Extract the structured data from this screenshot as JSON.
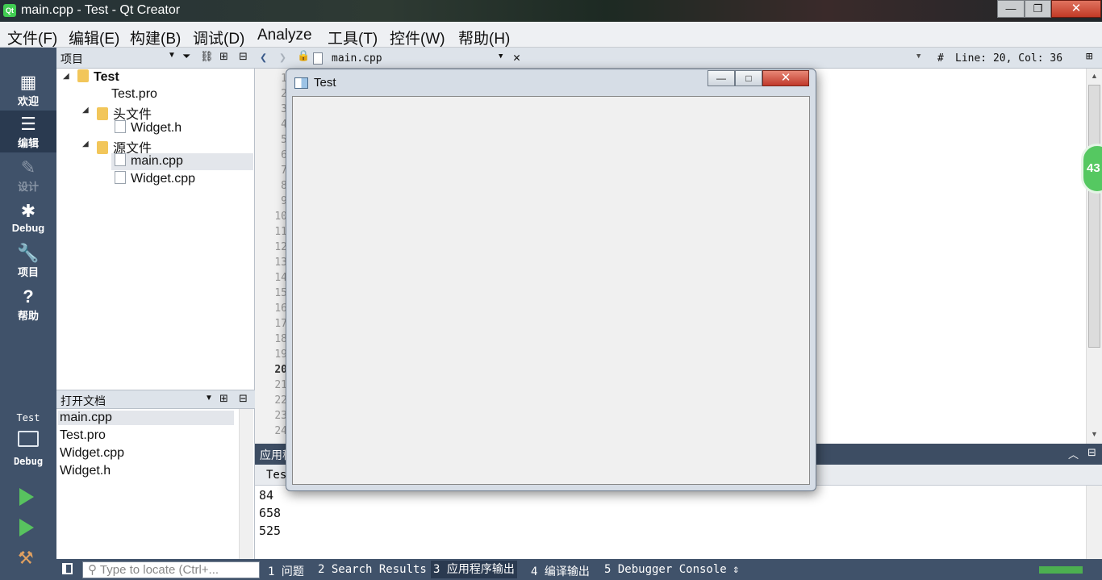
{
  "window": {
    "title": "main.cpp - Test - Qt Creator",
    "min_glyph": "—",
    "max_glyph": "❐",
    "close_glyph": "✕"
  },
  "menubar": [
    "文件(F)",
    "编辑(E)",
    "构建(B)",
    "调试(D)",
    "Analyze",
    "工具(T)",
    "控件(W)",
    "帮助(H)"
  ],
  "modes": [
    {
      "label": "欢迎",
      "icon": "grid-icon",
      "glyph": "▦"
    },
    {
      "label": "编辑",
      "icon": "edit-icon",
      "glyph": "☰"
    },
    {
      "label": "设计",
      "icon": "pencil-icon",
      "glyph": "✎"
    },
    {
      "label": "Debug",
      "icon": "bug-icon",
      "glyph": "✱"
    },
    {
      "label": "项目",
      "icon": "wrench-icon",
      "glyph": "🔧"
    },
    {
      "label": "帮助",
      "icon": "help-icon",
      "glyph": "?"
    }
  ],
  "kit": {
    "project": "Test",
    "config": "Debug"
  },
  "project_panel": {
    "title": "项目",
    "tree": [
      {
        "label": "Test",
        "level": 0,
        "kind": "project"
      },
      {
        "label": "Test.pro",
        "level": 1,
        "kind": "pro"
      },
      {
        "label": "头文件",
        "level": 1,
        "kind": "folder"
      },
      {
        "label": "Widget.h",
        "level": 2,
        "kind": "file"
      },
      {
        "label": "源文件",
        "level": 1,
        "kind": "folder"
      },
      {
        "label": "main.cpp",
        "level": 2,
        "kind": "file",
        "selected": true
      },
      {
        "label": "Widget.cpp",
        "level": 2,
        "kind": "file"
      }
    ]
  },
  "open_docs": {
    "title": "打开文档",
    "items": [
      "main.cpp",
      "Test.pro",
      "Widget.cpp",
      "Widget.h"
    ]
  },
  "editor": {
    "file": "main.cpp",
    "position": "Line: 20, Col: 36",
    "hash": "#",
    "line_numbers": [
      "1",
      "2",
      "3",
      "4",
      "5",
      "6",
      "7",
      "8",
      "9",
      "10",
      "11",
      "12",
      "13",
      "14",
      "15",
      "16",
      "17",
      "18",
      "19",
      "20",
      "21",
      "22",
      "23",
      "24"
    ],
    "current_line": "20"
  },
  "output": {
    "title": "应用程序输出",
    "tab": "Test",
    "lines": [
      "84",
      "658",
      "525"
    ]
  },
  "status": {
    "locator_placeholder": "Type to locate (Ctrl+...",
    "panes": [
      "1 问题",
      "2 Search Results",
      "3 应用程序输出",
      "4 编译输出",
      "5 Debugger Console"
    ],
    "active_pane": 2
  },
  "test_window": {
    "title": "Test",
    "min_glyph": "—",
    "max_glyph": "□",
    "close_glyph": "✕"
  },
  "badge": "43"
}
